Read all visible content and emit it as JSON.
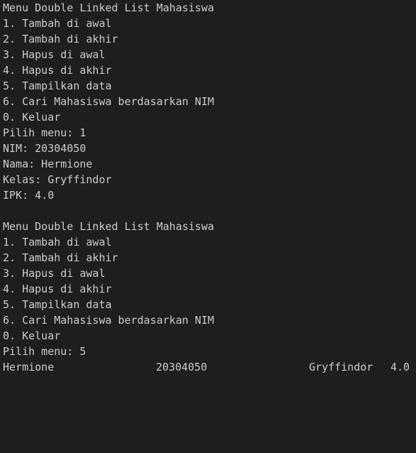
{
  "colors": {
    "background": "#1e1e1e",
    "text": "#cccccc"
  },
  "session1": {
    "menu_title": "Menu Double Linked List Mahasiswa",
    "menu_items": [
      "1. Tambah di awal",
      "2. Tambah di akhir",
      "3. Hapus di awal",
      "4. Hapus di akhir",
      "5. Tampilkan data",
      "6. Cari Mahasiswa berdasarkan NIM",
      "0. Keluar"
    ],
    "prompt": "Pilih menu: 1",
    "inputs": [
      "NIM: 20304050",
      "Nama: Hermione",
      "Kelas: Gryffindor",
      "IPK: 4.0"
    ]
  },
  "session2": {
    "menu_title": "Menu Double Linked List Mahasiswa",
    "menu_items": [
      "1. Tambah di awal",
      "2. Tambah di akhir",
      "3. Hapus di awal",
      "4. Hapus di akhir",
      "5. Tampilkan data",
      "6. Cari Mahasiswa berdasarkan NIM",
      "0. Keluar"
    ],
    "prompt": "Pilih menu: 5"
  },
  "data_table": {
    "rows": [
      {
        "nama": "Hermione",
        "nim": "20304050",
        "kelas": "Gryffindor",
        "ipk": "4.0"
      }
    ]
  }
}
